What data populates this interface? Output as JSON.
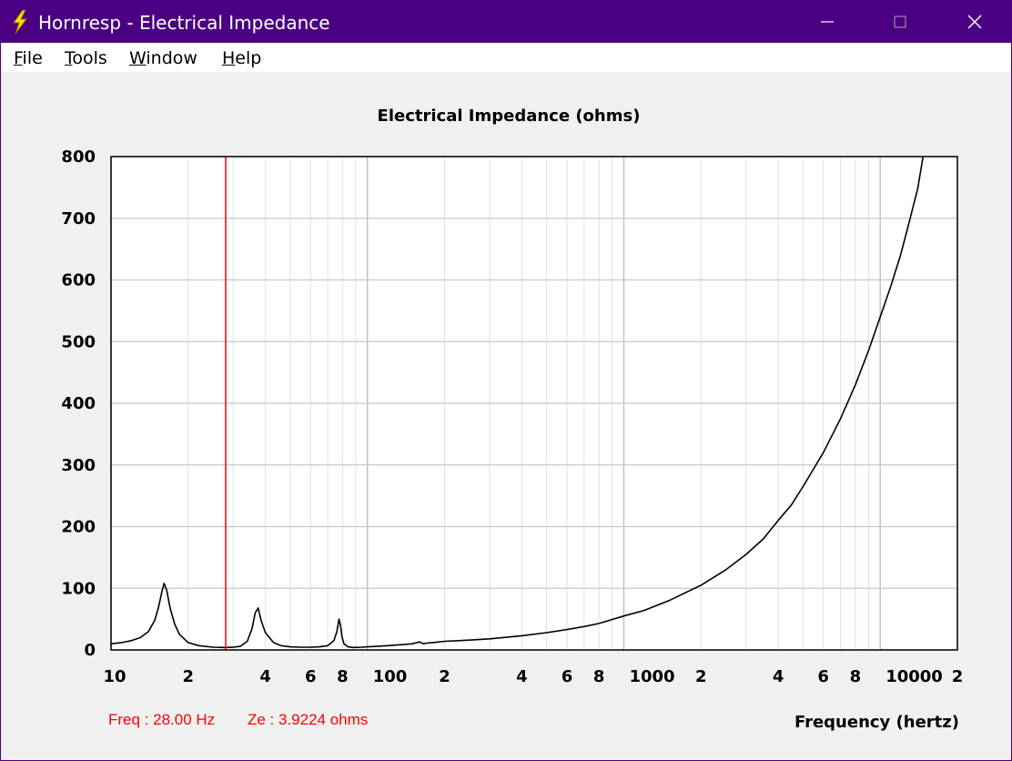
{
  "window": {
    "title": "Hornresp - Electrical Impedance",
    "controls": [
      "minimize",
      "maximize",
      "close"
    ]
  },
  "menu": {
    "items": [
      {
        "label": "File",
        "accel": "F",
        "rest": "ile"
      },
      {
        "label": "Tools",
        "accel": "T",
        "rest": "ools"
      },
      {
        "label": "Window",
        "accel": "W",
        "rest": "indow"
      },
      {
        "label": "Help",
        "accel": "H",
        "rest": "elp"
      }
    ]
  },
  "status": {
    "freq": "Freq : 28.00 Hz",
    "ze": "Ze : 3.9224 ohms"
  },
  "colors": {
    "titlebar": "#4b0082",
    "cursor": "#ff0000",
    "curve": "#000000",
    "grid": "#c8c8c8"
  },
  "chart_data": {
    "type": "line",
    "title": "Electrical Impedance (ohms)",
    "xlabel": "Frequency (hertz)",
    "ylabel": "",
    "xscale": "log",
    "xlim": [
      10,
      20000
    ],
    "ylim": [
      0,
      800
    ],
    "yticks": [
      0,
      100,
      200,
      300,
      400,
      500,
      600,
      700,
      800
    ],
    "xtick_labels": [
      {
        "value": 10,
        "label": "10"
      },
      {
        "value": 20,
        "label": "2"
      },
      {
        "value": 40,
        "label": "4"
      },
      {
        "value": 60,
        "label": "6"
      },
      {
        "value": 80,
        "label": "8"
      },
      {
        "value": 100,
        "label": "100"
      },
      {
        "value": 200,
        "label": "2"
      },
      {
        "value": 400,
        "label": "4"
      },
      {
        "value": 600,
        "label": "6"
      },
      {
        "value": 800,
        "label": "8"
      },
      {
        "value": 1000,
        "label": "1000"
      },
      {
        "value": 2000,
        "label": "2"
      },
      {
        "value": 4000,
        "label": "4"
      },
      {
        "value": 6000,
        "label": "6"
      },
      {
        "value": 8000,
        "label": "8"
      },
      {
        "value": 10000,
        "label": "10000"
      },
      {
        "value": 20000,
        "label": "2"
      }
    ],
    "cursor_x": 28,
    "grid": true,
    "series": [
      {
        "x": [
          10,
          11,
          12,
          13,
          14,
          14.8,
          15.3,
          15.8,
          16.1,
          16.5,
          17,
          17.7,
          18.5,
          20,
          22,
          25,
          28,
          30,
          32,
          34,
          35.5,
          36.5,
          37.5,
          38.5,
          40,
          43,
          46,
          50,
          55,
          60,
          65,
          70,
          74,
          76,
          77.5,
          78.5,
          79.5,
          81,
          84,
          88,
          95,
          100,
          110,
          120,
          130,
          140,
          150,
          160,
          165,
          170,
          180,
          200,
          250,
          300,
          400,
          500,
          600,
          700,
          800,
          1000,
          1200,
          1500,
          2000,
          2500,
          3000,
          3500,
          4000,
          4500,
          5000,
          6000,
          7000,
          8000,
          9000,
          10000,
          11000,
          12000,
          13000,
          14000,
          14700
        ],
        "y": [
          10,
          12,
          15,
          20,
          30,
          48,
          68,
          95,
          108,
          96,
          68,
          42,
          25,
          12,
          7,
          4.5,
          4,
          4.5,
          6,
          14,
          35,
          60,
          68,
          48,
          28,
          12,
          7,
          5,
          4.5,
          4.5,
          5,
          7,
          15,
          30,
          50,
          40,
          22,
          10,
          5,
          4,
          4.5,
          5,
          6,
          7,
          8,
          9,
          10,
          13,
          10,
          11,
          12,
          14,
          16,
          18,
          23,
          28,
          33,
          38,
          43,
          55,
          64,
          80,
          105,
          130,
          155,
          180,
          210,
          235,
          265,
          320,
          375,
          430,
          485,
          540,
          590,
          640,
          695,
          748,
          800
        ]
      }
    ]
  }
}
